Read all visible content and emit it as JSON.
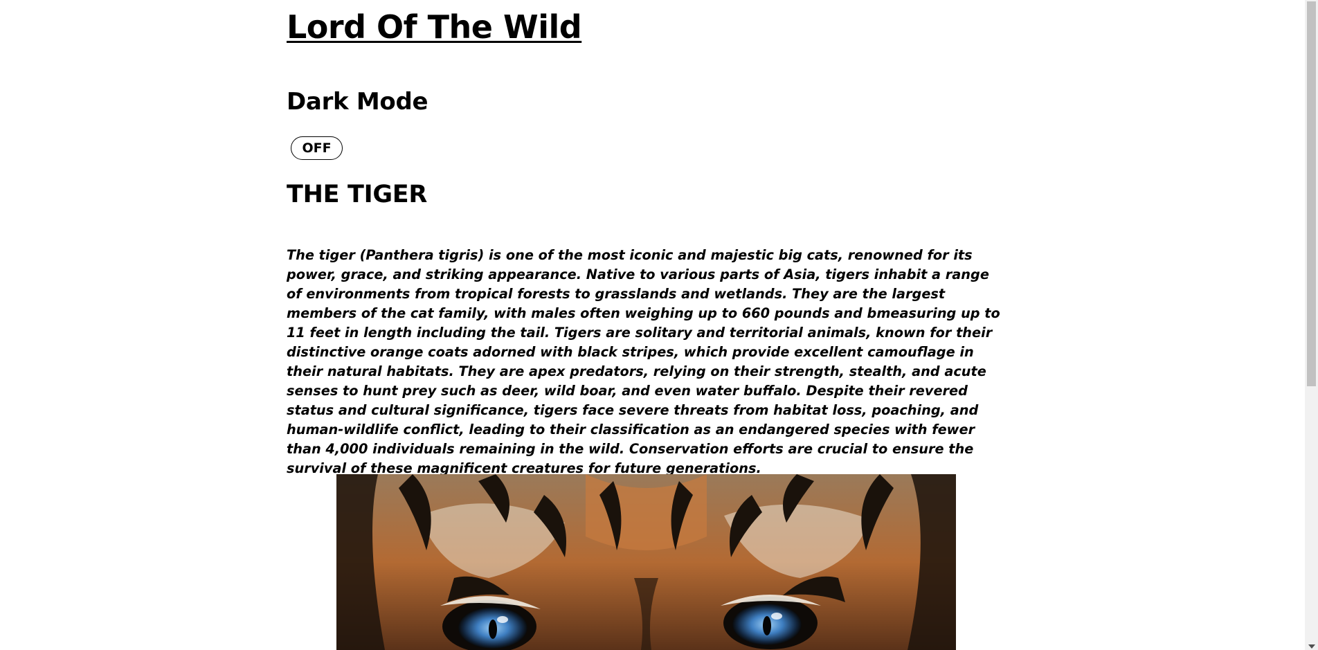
{
  "header": {
    "site_title": "Lord Of The Wild"
  },
  "dark_mode": {
    "heading": "Dark Mode",
    "toggle_label": "OFF"
  },
  "article": {
    "heading": "THE TIGER",
    "description": "The tiger (Panthera tigris) is one of the most iconic and majestic big cats, renowned for its power, grace, and striking appearance. Native to various parts of Asia, tigers inhabit a range of environments from tropical forests to grasslands and wetlands. They are the largest members of the cat family, with males often weighing up to 660 pounds and bmeasuring up to 11 feet in length including the tail. Tigers are solitary and territorial animals, known for their distinctive orange coats adorned with black stripes, which provide excellent camouflage in their natural habitats. They are apex predators, relying on their strength, stealth, and acute senses to hunt prey such as deer, wild boar, and even water buffalo. Despite their revered status and cultural significance, tigers face severe threats from habitat loss, poaching, and human-wildlife conflict, leading to their classification as an endangered species with fewer than 4,000 individuals remaining in the wild. Conservation efforts are crucial to ensure the survival of these magnificent creatures for future generations."
  },
  "image": {
    "subject": "tiger-face-blue-eyes"
  },
  "colors": {
    "background": "#ffffff",
    "text": "#000000",
    "scrollbar_track": "#f1f1f1",
    "scrollbar_thumb": "#c1c1c1"
  }
}
